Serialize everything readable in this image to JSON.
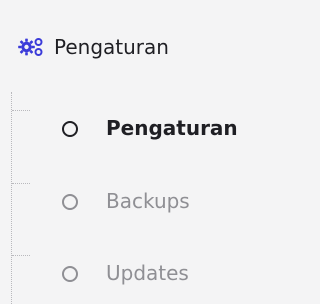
{
  "menu": {
    "title": "Pengaturan",
    "icon": "gears-icon",
    "accent_color": "#3b3bd9",
    "items": [
      {
        "label": "Pengaturan",
        "icon": "circle-outline-icon",
        "active": true
      },
      {
        "label": "Backups",
        "icon": "circle-outline-icon",
        "active": false
      },
      {
        "label": "Updates",
        "icon": "circle-outline-icon",
        "active": false
      }
    ]
  }
}
